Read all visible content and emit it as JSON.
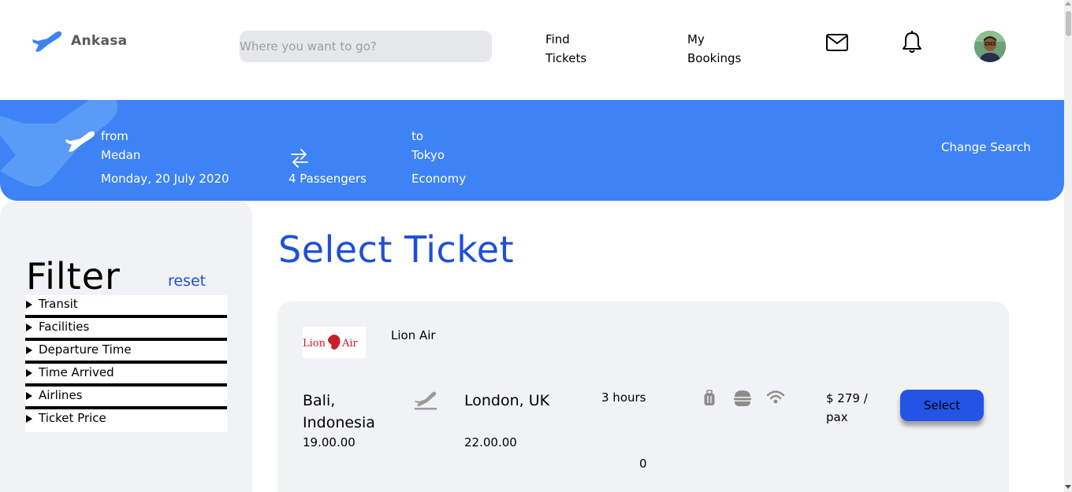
{
  "header": {
    "brand": "Ankasa",
    "search_placeholder": "Where you want to go?",
    "nav": [
      {
        "label": "Find Tickets"
      },
      {
        "label": "My Bookings"
      }
    ],
    "icons": [
      "mail-icon",
      "bell-icon",
      "avatar"
    ]
  },
  "banner": {
    "from_label": "from",
    "from_city": "Medan",
    "date": "Monday, 20 July 2020",
    "passengers": "4 Passengers",
    "to_label": "to",
    "to_city": "Tokyo",
    "class": "Economy",
    "change_search": "Change Search"
  },
  "filter": {
    "title": "Filter",
    "reset": "reset",
    "items": [
      "Transit",
      "Facilities",
      "Departure Time",
      "Time Arrived",
      "Airlines",
      "Ticket Price"
    ]
  },
  "main": {
    "title": "Select Ticket",
    "tickets": [
      {
        "airline": "Lion Air",
        "airline_logo_text": "LionAir",
        "from": "Bali, Indonesia",
        "departure": "19.00.00",
        "to": "London, UK",
        "arrival": "22.00.00",
        "duration": "3 hours",
        "transit": "0",
        "price": "$ 279 / pax",
        "select_label": "Select"
      }
    ]
  },
  "colors": {
    "accent": "#3d83f5",
    "title_blue": "#1f4fd8",
    "button_blue": "#2454e6",
    "airline_red": "#c8202a"
  }
}
